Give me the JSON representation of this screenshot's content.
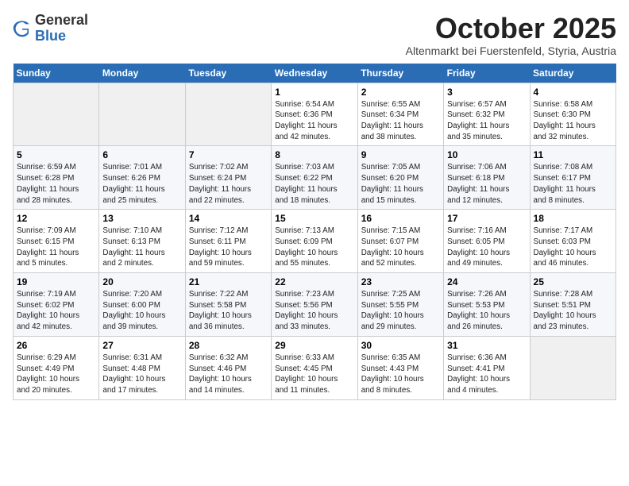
{
  "header": {
    "logo_general": "General",
    "logo_blue": "Blue",
    "month": "October 2025",
    "location": "Altenmarkt bei Fuerstenfeld, Styria, Austria"
  },
  "weekdays": [
    "Sunday",
    "Monday",
    "Tuesday",
    "Wednesday",
    "Thursday",
    "Friday",
    "Saturday"
  ],
  "weeks": [
    [
      {
        "day": "",
        "info": ""
      },
      {
        "day": "",
        "info": ""
      },
      {
        "day": "",
        "info": ""
      },
      {
        "day": "1",
        "info": "Sunrise: 6:54 AM\nSunset: 6:36 PM\nDaylight: 11 hours\nand 42 minutes."
      },
      {
        "day": "2",
        "info": "Sunrise: 6:55 AM\nSunset: 6:34 PM\nDaylight: 11 hours\nand 38 minutes."
      },
      {
        "day": "3",
        "info": "Sunrise: 6:57 AM\nSunset: 6:32 PM\nDaylight: 11 hours\nand 35 minutes."
      },
      {
        "day": "4",
        "info": "Sunrise: 6:58 AM\nSunset: 6:30 PM\nDaylight: 11 hours\nand 32 minutes."
      }
    ],
    [
      {
        "day": "5",
        "info": "Sunrise: 6:59 AM\nSunset: 6:28 PM\nDaylight: 11 hours\nand 28 minutes."
      },
      {
        "day": "6",
        "info": "Sunrise: 7:01 AM\nSunset: 6:26 PM\nDaylight: 11 hours\nand 25 minutes."
      },
      {
        "day": "7",
        "info": "Sunrise: 7:02 AM\nSunset: 6:24 PM\nDaylight: 11 hours\nand 22 minutes."
      },
      {
        "day": "8",
        "info": "Sunrise: 7:03 AM\nSunset: 6:22 PM\nDaylight: 11 hours\nand 18 minutes."
      },
      {
        "day": "9",
        "info": "Sunrise: 7:05 AM\nSunset: 6:20 PM\nDaylight: 11 hours\nand 15 minutes."
      },
      {
        "day": "10",
        "info": "Sunrise: 7:06 AM\nSunset: 6:18 PM\nDaylight: 11 hours\nand 12 minutes."
      },
      {
        "day": "11",
        "info": "Sunrise: 7:08 AM\nSunset: 6:17 PM\nDaylight: 11 hours\nand 8 minutes."
      }
    ],
    [
      {
        "day": "12",
        "info": "Sunrise: 7:09 AM\nSunset: 6:15 PM\nDaylight: 11 hours\nand 5 minutes."
      },
      {
        "day": "13",
        "info": "Sunrise: 7:10 AM\nSunset: 6:13 PM\nDaylight: 11 hours\nand 2 minutes."
      },
      {
        "day": "14",
        "info": "Sunrise: 7:12 AM\nSunset: 6:11 PM\nDaylight: 10 hours\nand 59 minutes."
      },
      {
        "day": "15",
        "info": "Sunrise: 7:13 AM\nSunset: 6:09 PM\nDaylight: 10 hours\nand 55 minutes."
      },
      {
        "day": "16",
        "info": "Sunrise: 7:15 AM\nSunset: 6:07 PM\nDaylight: 10 hours\nand 52 minutes."
      },
      {
        "day": "17",
        "info": "Sunrise: 7:16 AM\nSunset: 6:05 PM\nDaylight: 10 hours\nand 49 minutes."
      },
      {
        "day": "18",
        "info": "Sunrise: 7:17 AM\nSunset: 6:03 PM\nDaylight: 10 hours\nand 46 minutes."
      }
    ],
    [
      {
        "day": "19",
        "info": "Sunrise: 7:19 AM\nSunset: 6:02 PM\nDaylight: 10 hours\nand 42 minutes."
      },
      {
        "day": "20",
        "info": "Sunrise: 7:20 AM\nSunset: 6:00 PM\nDaylight: 10 hours\nand 39 minutes."
      },
      {
        "day": "21",
        "info": "Sunrise: 7:22 AM\nSunset: 5:58 PM\nDaylight: 10 hours\nand 36 minutes."
      },
      {
        "day": "22",
        "info": "Sunrise: 7:23 AM\nSunset: 5:56 PM\nDaylight: 10 hours\nand 33 minutes."
      },
      {
        "day": "23",
        "info": "Sunrise: 7:25 AM\nSunset: 5:55 PM\nDaylight: 10 hours\nand 29 minutes."
      },
      {
        "day": "24",
        "info": "Sunrise: 7:26 AM\nSunset: 5:53 PM\nDaylight: 10 hours\nand 26 minutes."
      },
      {
        "day": "25",
        "info": "Sunrise: 7:28 AM\nSunset: 5:51 PM\nDaylight: 10 hours\nand 23 minutes."
      }
    ],
    [
      {
        "day": "26",
        "info": "Sunrise: 6:29 AM\nSunset: 4:49 PM\nDaylight: 10 hours\nand 20 minutes."
      },
      {
        "day": "27",
        "info": "Sunrise: 6:31 AM\nSunset: 4:48 PM\nDaylight: 10 hours\nand 17 minutes."
      },
      {
        "day": "28",
        "info": "Sunrise: 6:32 AM\nSunset: 4:46 PM\nDaylight: 10 hours\nand 14 minutes."
      },
      {
        "day": "29",
        "info": "Sunrise: 6:33 AM\nSunset: 4:45 PM\nDaylight: 10 hours\nand 11 minutes."
      },
      {
        "day": "30",
        "info": "Sunrise: 6:35 AM\nSunset: 4:43 PM\nDaylight: 10 hours\nand 8 minutes."
      },
      {
        "day": "31",
        "info": "Sunrise: 6:36 AM\nSunset: 4:41 PM\nDaylight: 10 hours\nand 4 minutes."
      },
      {
        "day": "",
        "info": ""
      }
    ]
  ]
}
